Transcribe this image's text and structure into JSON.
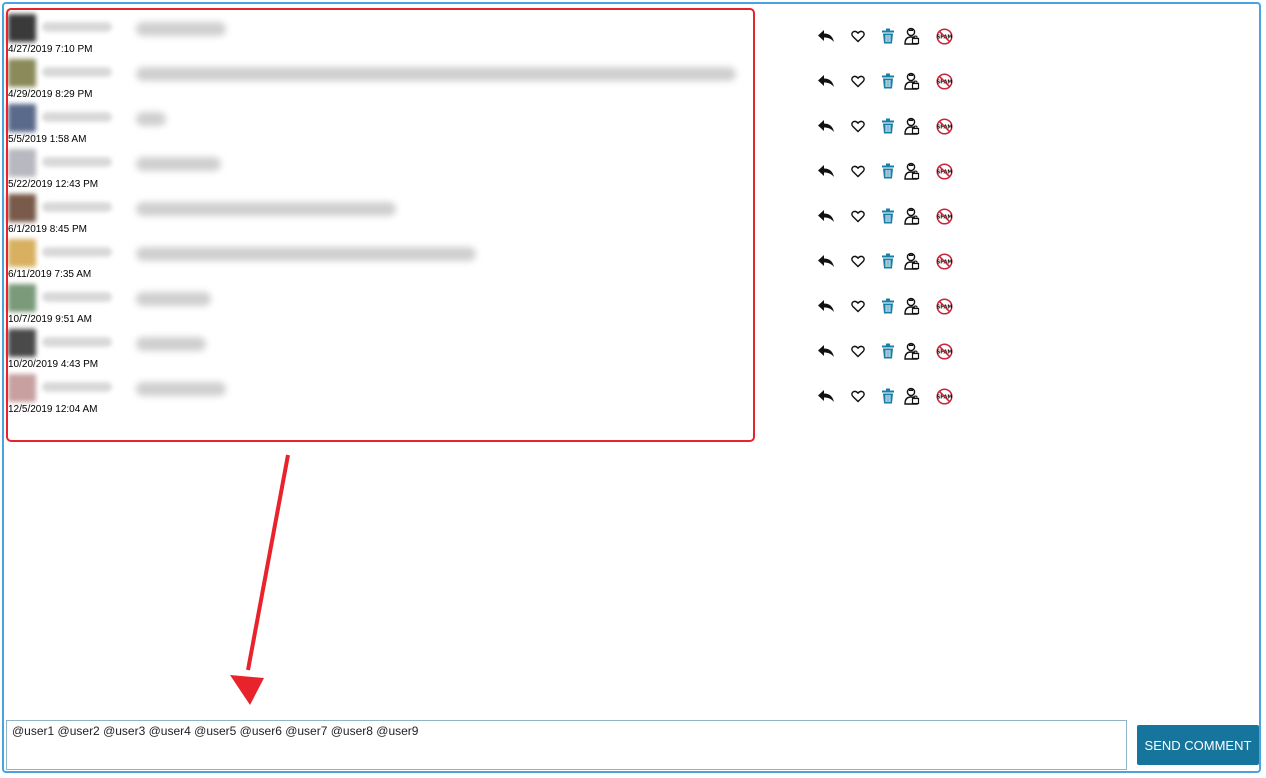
{
  "comments": [
    {
      "timestamp": "4/27/2019 7:10 PM",
      "avatar_color": "#3a3a3a"
    },
    {
      "timestamp": "4/29/2019 8:29 PM",
      "avatar_color": "#8a8a5a"
    },
    {
      "timestamp": "5/5/2019 1:58 AM",
      "avatar_color": "#5a6a8a"
    },
    {
      "timestamp": "5/22/2019 12:43 PM",
      "avatar_color": "#b8b8c0"
    },
    {
      "timestamp": "6/1/2019 8:45 PM",
      "avatar_color": "#7a5a4a"
    },
    {
      "timestamp": "6/11/2019 7:35 AM",
      "avatar_color": "#d8b060"
    },
    {
      "timestamp": "10/7/2019 9:51 AM",
      "avatar_color": "#7a9a7a"
    },
    {
      "timestamp": "10/20/2019 4:43 PM",
      "avatar_color": "#4a4a4a"
    },
    {
      "timestamp": "12/5/2019 12:04 AM",
      "avatar_color": "#c8a0a0"
    }
  ],
  "actions": [
    "reply-icon",
    "heart-icon",
    "trash-icon",
    "user-block-icon",
    "spam-icon"
  ],
  "colors": {
    "frame": "#4aa3df",
    "highlight": "#e8232b",
    "trash": "#1a7fa8",
    "button": "#16759c"
  },
  "comment_input": {
    "value": "@user1 @user2 @user3 @user4 @user5 @user6 @user7 @user8 @user9"
  },
  "send_button": {
    "label": "SEND COMMENT"
  }
}
